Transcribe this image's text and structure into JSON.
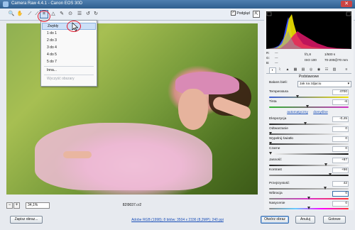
{
  "window": {
    "title": "Camera Raw 4.4.1 - Canon EOS 30D"
  },
  "toolbar": {
    "preview_label": "Podgląd",
    "preview_checked": "✓"
  },
  "dropdown": {
    "items": [
      "Zwykły",
      "1 do 1",
      "2 do 3",
      "3 do 4",
      "4 do 5",
      "5 do 7",
      "Inna...",
      "Wyczyść obszary"
    ]
  },
  "image": {
    "zoom": "34,1%",
    "filename": "82I9037.cr2"
  },
  "readouts": {
    "r_label": "R:",
    "r_value": "---",
    "g_label": "G:",
    "g_value": "---",
    "b_label": "B:",
    "b_value": "---",
    "aperture": "f/1,8",
    "shutter": "1/500 s",
    "iso": "ISO 100",
    "lens": "70-200@70 mm"
  },
  "panel": {
    "title": "Podstawowe",
    "white_balance_label": "Balans bieli:",
    "white_balance_value": "Jak na zdjęciu",
    "auto_link": "automatyczny",
    "default_link": "domyślne",
    "sliders": [
      {
        "label": "Temperatura",
        "value": "4700",
        "level": 0.35
      },
      {
        "label": "Tinta",
        "value": "-6",
        "level": 0.48
      },
      {
        "label": "Ekspozycja",
        "value": "-0,45",
        "level": 0.45
      },
      {
        "label": "Odtwarzanie",
        "value": "0",
        "level": 0.0
      },
      {
        "label": "Wypełnij światło",
        "value": "0",
        "level": 0.0
      },
      {
        "label": "Czarne",
        "value": "0",
        "level": 0.0
      },
      {
        "label": "Jasność",
        "value": "+87",
        "level": 0.72
      },
      {
        "label": "Kontrast",
        "value": "+56",
        "level": 0.78
      },
      {
        "label": "Przejrzystość",
        "value": "42",
        "level": 0.71
      },
      {
        "label": "Wibracja",
        "value": "0",
        "level": 0.5
      },
      {
        "label": "Nasycenie",
        "value": "0",
        "level": 0.5
      }
    ]
  },
  "bottom": {
    "save_button": "Zapisz obraz...",
    "workflow_link": "Adobe RGB (1998); 8 bitów; 3504 x 2336 (8,2MP); 240 ppi",
    "open_button": "Otwórz obraz",
    "cancel_button": "Anuluj",
    "done_button": "Gotowe"
  },
  "colors": {
    "accent": "#3a6fa8",
    "highlight": "#e0142a",
    "link": "#1a4fb8"
  }
}
